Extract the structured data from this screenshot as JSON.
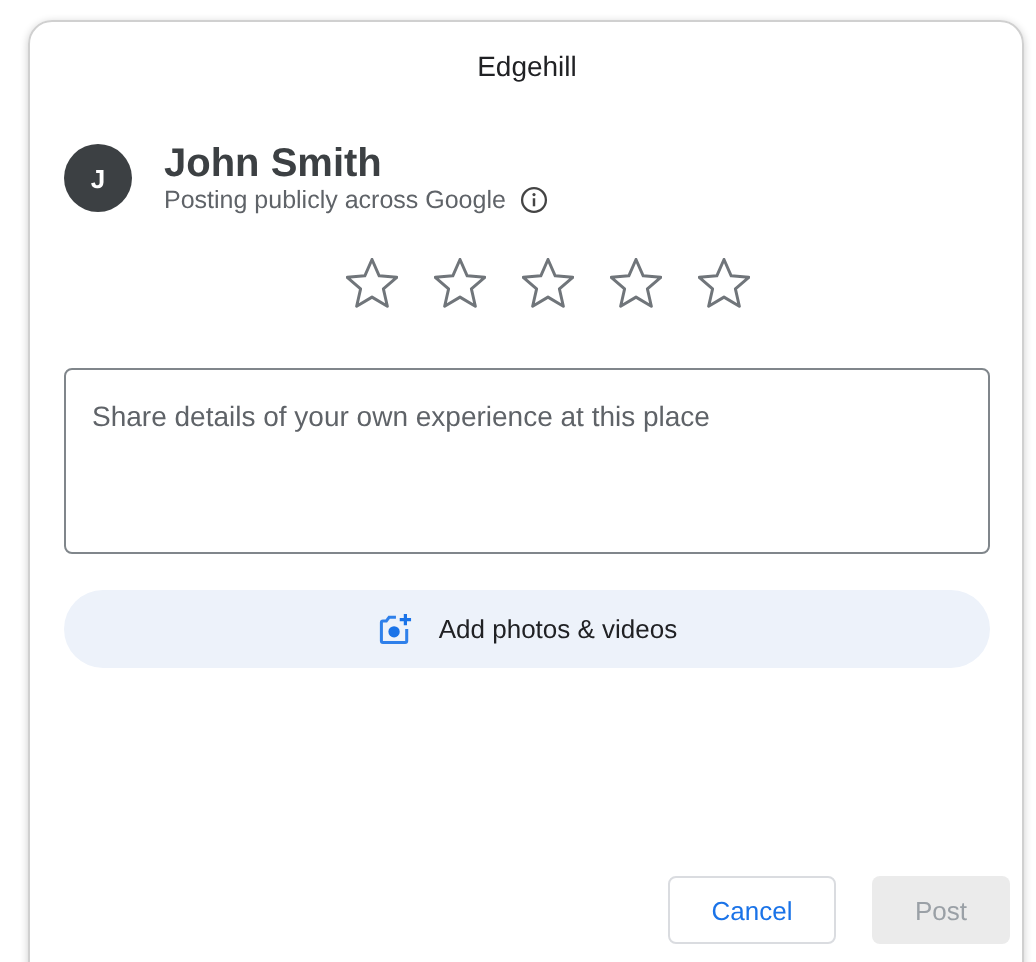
{
  "dialog": {
    "title": "Edgehill"
  },
  "user": {
    "initial": "J",
    "name": "John Smith",
    "subtitle": "Posting publicly across Google"
  },
  "rating": {
    "stars": 0
  },
  "review": {
    "placeholder": "Share details of your own experience at this place"
  },
  "add_media": {
    "label": "Add photos & videos"
  },
  "buttons": [
    {
      "label": "Cancel",
      "kind": "secondary",
      "disabled": false
    },
    {
      "label": "Post",
      "kind": "primary",
      "disabled": true
    }
  ]
}
